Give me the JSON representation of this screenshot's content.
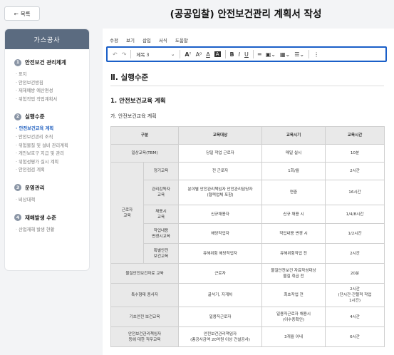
{
  "header": {
    "back_label": "목록",
    "title": "(공공입찰) 안전보건관리 계획서 작성"
  },
  "sidebar": {
    "title": "가스공사",
    "sections": [
      {
        "num": "1",
        "title": "안전보건 관리체계",
        "items": [
          "표지",
          "안전보건방침",
          "재해예방 예산편성",
          "위험작업 작업계획서"
        ]
      },
      {
        "num": "2",
        "title": "실행수준",
        "items": [
          "안전보건교육 계획",
          "안전보건관리 조직",
          "위험물질 및 설비 관리계획",
          "개인보호구 지급 및 관리",
          "위험성평가 실시 계획",
          "안전점검 계획"
        ]
      },
      {
        "num": "3",
        "title": "운영관리",
        "items": [
          "비상대책"
        ]
      },
      {
        "num": "4",
        "title": "재해발생 수준",
        "items": [
          "산업재해 발생 현황"
        ]
      }
    ]
  },
  "menubar": [
    "수정",
    "보기",
    "삽입",
    "서식",
    "도움말"
  ],
  "toolbar": {
    "style": "제목 3",
    "icons": [
      "undo-icon",
      "redo-icon",
      "font-size-icon",
      "superscript-icon",
      "font-color-icon",
      "highlight-icon",
      "bold-icon",
      "italic-icon",
      "underline-icon",
      "hr-icon",
      "image-icon",
      "table-icon",
      "align-icon",
      "more-icon"
    ]
  },
  "doc": {
    "heading": "Ⅱ. 실행수준",
    "subheading": "1. 안전보건교육 계획",
    "subsubheading": "가. 안전보건교육 계획",
    "table": {
      "headers": [
        "구분",
        "교육대상",
        "교육시기",
        "교육시간"
      ],
      "r1": [
        "일상교육(TBM)",
        "당일 작업 근로자",
        "매일 실시",
        "10분"
      ],
      "group": "근로자\n교육",
      "g1": [
        "정기교육",
        "전 근로자",
        "1회/월",
        "2시간"
      ],
      "g2": [
        "관리감독자\n교육",
        "분야별 안전관리책임자 안전관리담당자\n(협력업체 포함)",
        "연중",
        "16시간"
      ],
      "g3": [
        "채용시\n교육",
        "신규채용자",
        "신규 채용 시",
        "1/4/8시간"
      ],
      "g4": [
        "작업내용\n변경시교육",
        "해당작업자",
        "작업내용 변경 시",
        "1/2시간"
      ],
      "g5": [
        "특별안전\n보건교육",
        "유해위험 해당작업자",
        "유해위험작업 전",
        "2시간"
      ],
      "r2": [
        "물질안전보건자료 교육",
        "근로자",
        "물질안전보건 자료작성대상\n물질 취급 전",
        "20분"
      ],
      "r3": [
        "특수형태 종사자",
        "굴삭기, 지게차",
        "최초작업 전",
        "2시간\n(단시간·간헐적 작업\n1시간)"
      ],
      "r4": [
        "기초안전 보건교육",
        "일용직근로자",
        "일용직근로자 채용시\n(이수증확인)",
        "4시간"
      ],
      "r5": [
        "안전보건관리책임자\n등에 대한 직무교육",
        "안전보건관리책임자\n(총공사금액 20억원 이상 건설공사)",
        "3개월 이내",
        "6시간"
      ]
    }
  }
}
